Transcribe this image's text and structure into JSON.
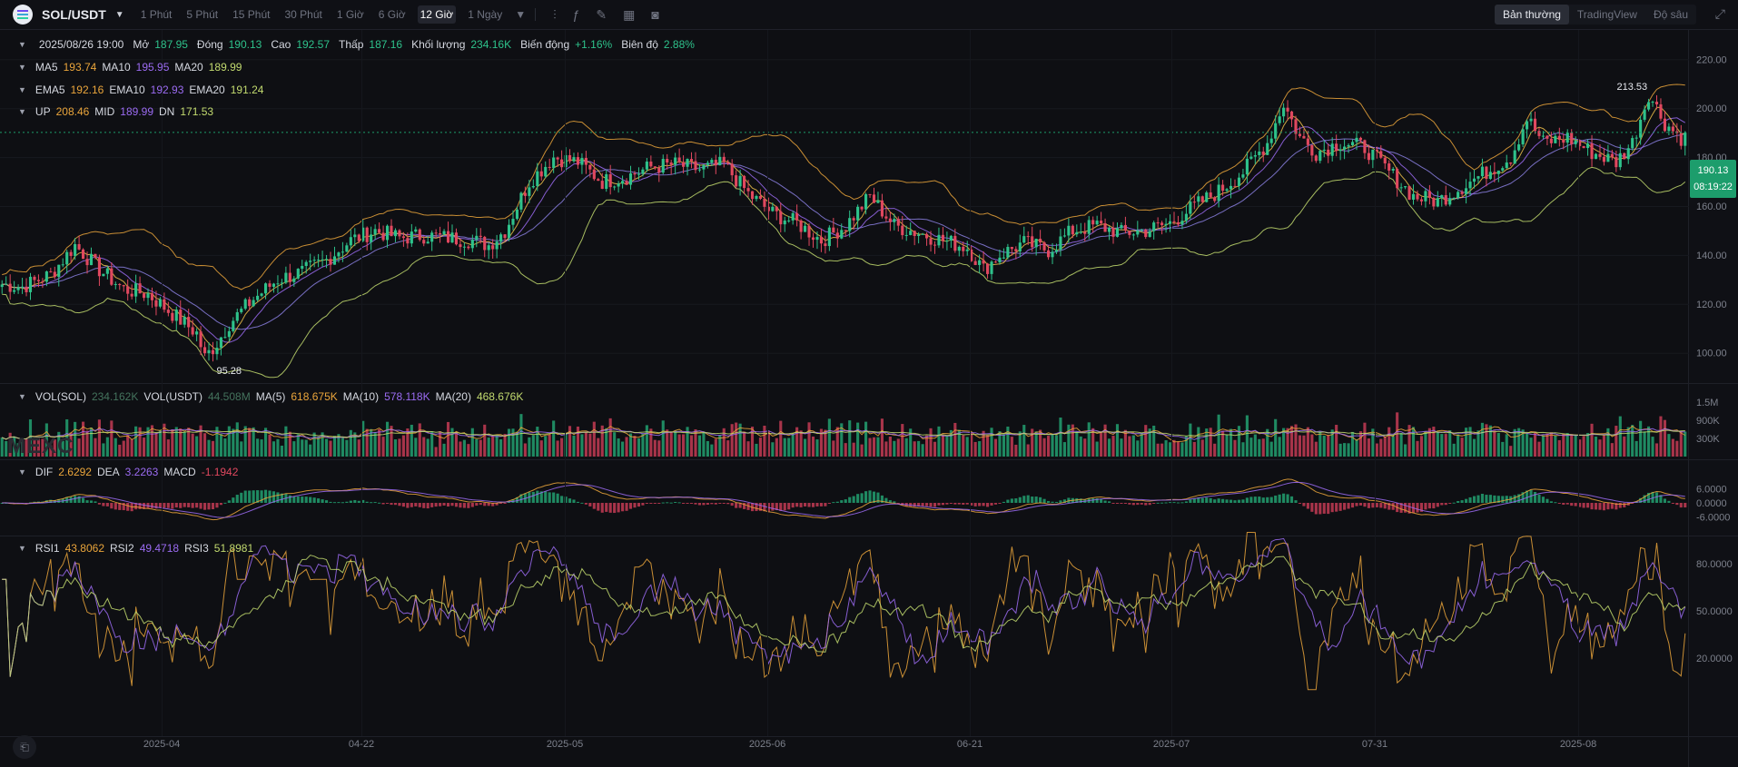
{
  "header": {
    "pair": "SOL/USDT",
    "timeframes": [
      "1 Phút",
      "5 Phút",
      "15 Phút",
      "30 Phút",
      "1 Giờ",
      "6 Giờ",
      "12 Giờ"
    ],
    "active_timeframe": "12 Giờ",
    "timeframe_dropdown": "1 Ngày",
    "views": [
      "Bản thường",
      "TradingView",
      "Độ sâu"
    ],
    "active_view": "Bản thường"
  },
  "ohlc": {
    "date": "2025/08/26 19:00",
    "open_label": "Mở",
    "open": "187.95",
    "close_label": "Đóng",
    "close": "190.13",
    "high_label": "Cao",
    "high": "192.57",
    "low_label": "Thấp",
    "low": "187.16",
    "volume_label": "Khối lượng",
    "volume": "234.16K",
    "change_label": "Biến động",
    "change": "+1.16%",
    "amplitude_label": "Biên độ",
    "amplitude": "2.88%"
  },
  "ma": {
    "ma5_label": "MA5",
    "ma5": "193.74",
    "ma10_label": "MA10",
    "ma10": "195.95",
    "ma20_label": "MA20",
    "ma20": "189.99"
  },
  "ema": {
    "ema5_label": "EMA5",
    "ema5": "192.16",
    "ema10_label": "EMA10",
    "ema10": "192.93",
    "ema20_label": "EMA20",
    "ema20": "191.24"
  },
  "boll": {
    "up_label": "UP",
    "up": "208.46",
    "mid_label": "MID",
    "mid": "189.99",
    "dn_label": "DN",
    "dn": "171.53"
  },
  "vol": {
    "vol_sol_label": "VOL(SOL)",
    "vol_sol": "234.162K",
    "vol_usdt_label": "VOL(USDT)",
    "vol_usdt": "44.508M",
    "ma5_label": "MA(5)",
    "ma5": "618.675K",
    "ma10_label": "MA(10)",
    "ma10": "578.118K",
    "ma20_label": "MA(20)",
    "ma20": "468.676K"
  },
  "macd": {
    "dif_label": "DIF",
    "dif": "2.6292",
    "dea_label": "DEA",
    "dea": "3.2263",
    "macd_label": "MACD",
    "macd": "-1.1942"
  },
  "rsi": {
    "rsi1_label": "RSI1",
    "rsi1": "43.8062",
    "rsi2_label": "RSI2",
    "rsi2": "49.4718",
    "rsi3_label": "RSI3",
    "rsi3": "51.8981"
  },
  "watermark": "MEXC",
  "current_price": "190.13",
  "countdown": "08:19:22",
  "colors": {
    "up": "#2ec28b",
    "down": "#e0485f",
    "ma5": "#eaa53b",
    "ma10": "#9b6bf2",
    "ma20": "#c2da6f",
    "tag": "#1d9d6c"
  },
  "chart_data": {
    "type": "candlestick",
    "interval": "12 Giờ",
    "price_axis": {
      "ticks": [
        "220.00",
        "200.00",
        "180.00",
        "160.00",
        "140.00",
        "120.00",
        "100.00"
      ],
      "range": [
        88,
        232
      ]
    },
    "volume_axis": {
      "ticks": [
        "1.5M",
        "900K",
        "300K"
      ]
    },
    "macd_axis": {
      "ticks": [
        "6.0000",
        "0.0000",
        "-6.0000"
      ]
    },
    "rsi_axis": {
      "ticks": [
        "80.0000",
        "50.0000",
        "20.0000"
      ]
    },
    "x_ticks": [
      "2025-04",
      "04-22",
      "2025-05",
      "2025-06",
      "06-21",
      "2025-07",
      "07-31",
      "2025-08"
    ],
    "annotations": [
      {
        "text": "213.53",
        "type": "max"
      },
      {
        "text": "95.28",
        "type": "min"
      }
    ],
    "price_path": [
      {
        "t": 0,
        "p": 128
      },
      {
        "t": 5,
        "p": 127
      },
      {
        "t": 12,
        "p": 132
      },
      {
        "t": 18,
        "p": 144
      },
      {
        "t": 24,
        "p": 134
      },
      {
        "t": 30,
        "p": 126
      },
      {
        "t": 36,
        "p": 124
      },
      {
        "t": 42,
        "p": 116
      },
      {
        "t": 48,
        "p": 108
      },
      {
        "t": 50,
        "p": 98
      },
      {
        "t": 53,
        "p": 104
      },
      {
        "t": 56,
        "p": 112
      },
      {
        "t": 62,
        "p": 122
      },
      {
        "t": 68,
        "p": 130
      },
      {
        "t": 74,
        "p": 133
      },
      {
        "t": 80,
        "p": 138
      },
      {
        "t": 86,
        "p": 146
      },
      {
        "t": 92,
        "p": 150
      },
      {
        "t": 98,
        "p": 147
      },
      {
        "t": 104,
        "p": 148
      },
      {
        "t": 110,
        "p": 147
      },
      {
        "t": 116,
        "p": 146
      },
      {
        "t": 120,
        "p": 144
      },
      {
        "t": 124,
        "p": 150
      },
      {
        "t": 130,
        "p": 170
      },
      {
        "t": 136,
        "p": 180
      },
      {
        "t": 142,
        "p": 178
      },
      {
        "t": 148,
        "p": 170
      },
      {
        "t": 154,
        "p": 172
      },
      {
        "t": 160,
        "p": 176
      },
      {
        "t": 166,
        "p": 177
      },
      {
        "t": 172,
        "p": 175
      },
      {
        "t": 178,
        "p": 177
      },
      {
        "t": 184,
        "p": 165
      },
      {
        "t": 190,
        "p": 157
      },
      {
        "t": 196,
        "p": 153
      },
      {
        "t": 202,
        "p": 146
      },
      {
        "t": 208,
        "p": 152
      },
      {
        "t": 214,
        "p": 164
      },
      {
        "t": 220,
        "p": 152
      },
      {
        "t": 226,
        "p": 149
      },
      {
        "t": 232,
        "p": 146
      },
      {
        "t": 238,
        "p": 143
      },
      {
        "t": 242,
        "p": 134
      },
      {
        "t": 246,
        "p": 140
      },
      {
        "t": 252,
        "p": 145
      },
      {
        "t": 258,
        "p": 142
      },
      {
        "t": 264,
        "p": 150
      },
      {
        "t": 270,
        "p": 152
      },
      {
        "t": 276,
        "p": 149
      },
      {
        "t": 282,
        "p": 150
      },
      {
        "t": 288,
        "p": 153
      },
      {
        "t": 294,
        "p": 160
      },
      {
        "t": 300,
        "p": 166
      },
      {
        "t": 306,
        "p": 174
      },
      {
        "t": 312,
        "p": 186
      },
      {
        "t": 316,
        "p": 202
      },
      {
        "t": 320,
        "p": 188
      },
      {
        "t": 324,
        "p": 182
      },
      {
        "t": 330,
        "p": 186
      },
      {
        "t": 336,
        "p": 184
      },
      {
        "t": 342,
        "p": 174
      },
      {
        "t": 348,
        "p": 164
      },
      {
        "t": 354,
        "p": 162
      },
      {
        "t": 360,
        "p": 168
      },
      {
        "t": 366,
        "p": 174
      },
      {
        "t": 372,
        "p": 180
      },
      {
        "t": 376,
        "p": 196
      },
      {
        "t": 380,
        "p": 186
      },
      {
        "t": 386,
        "p": 188
      },
      {
        "t": 392,
        "p": 182
      },
      {
        "t": 398,
        "p": 178
      },
      {
        "t": 402,
        "p": 186
      },
      {
        "t": 406,
        "p": 206
      },
      {
        "t": 410,
        "p": 194
      },
      {
        "t": 414,
        "p": 188
      }
    ]
  }
}
